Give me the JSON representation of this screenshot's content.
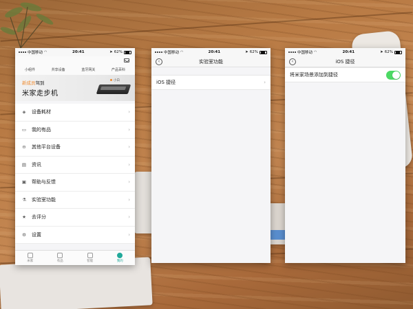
{
  "status": {
    "carrier": "中国移动",
    "time": "20:41",
    "battery": "62%"
  },
  "phone1": {
    "quick_tabs": [
      "小组件",
      "共享设备",
      "蓝牙网关",
      "产品百科"
    ],
    "banner": {
      "highlight": "新成员",
      "subtitle_rest": "驾到",
      "title": "米家走步机",
      "logo_text": "小白"
    },
    "menu": [
      {
        "label": "设备耗材",
        "icon": "box-icon",
        "glyph": "◈"
      },
      {
        "label": "我的有品",
        "icon": "shopping-bag-icon",
        "glyph": "▭"
      },
      {
        "label": "其他平台设备",
        "icon": "platform-icon",
        "glyph": "⊖"
      },
      {
        "label": "资讯",
        "icon": "news-icon",
        "glyph": "▤"
      },
      {
        "label": "帮助与反馈",
        "icon": "help-icon",
        "glyph": "▣"
      },
      {
        "label": "实验室功能",
        "icon": "lab-icon",
        "glyph": "⚗"
      },
      {
        "label": "去评分",
        "icon": "star-icon",
        "glyph": "★"
      },
      {
        "label": "设置",
        "icon": "gear-icon",
        "glyph": "⚙"
      }
    ],
    "tabs": [
      {
        "label": "米家",
        "icon": "home-tab-icon"
      },
      {
        "label": "有品",
        "icon": "shop-tab-icon"
      },
      {
        "label": "智能",
        "icon": "smart-tab-icon"
      },
      {
        "label": "我的",
        "icon": "profile-tab-icon",
        "active": true
      }
    ]
  },
  "phone2": {
    "title": "实验室功能",
    "row_label": "iOS 捷径"
  },
  "phone3": {
    "title": "iOS 捷径",
    "row_label": "将米家场景添加到捷径",
    "toggle_on": true,
    "toggle_color": "#4cd964"
  },
  "colors": {
    "accent_teal": "#21a99a",
    "banner_orange": "#ef8a2d"
  }
}
